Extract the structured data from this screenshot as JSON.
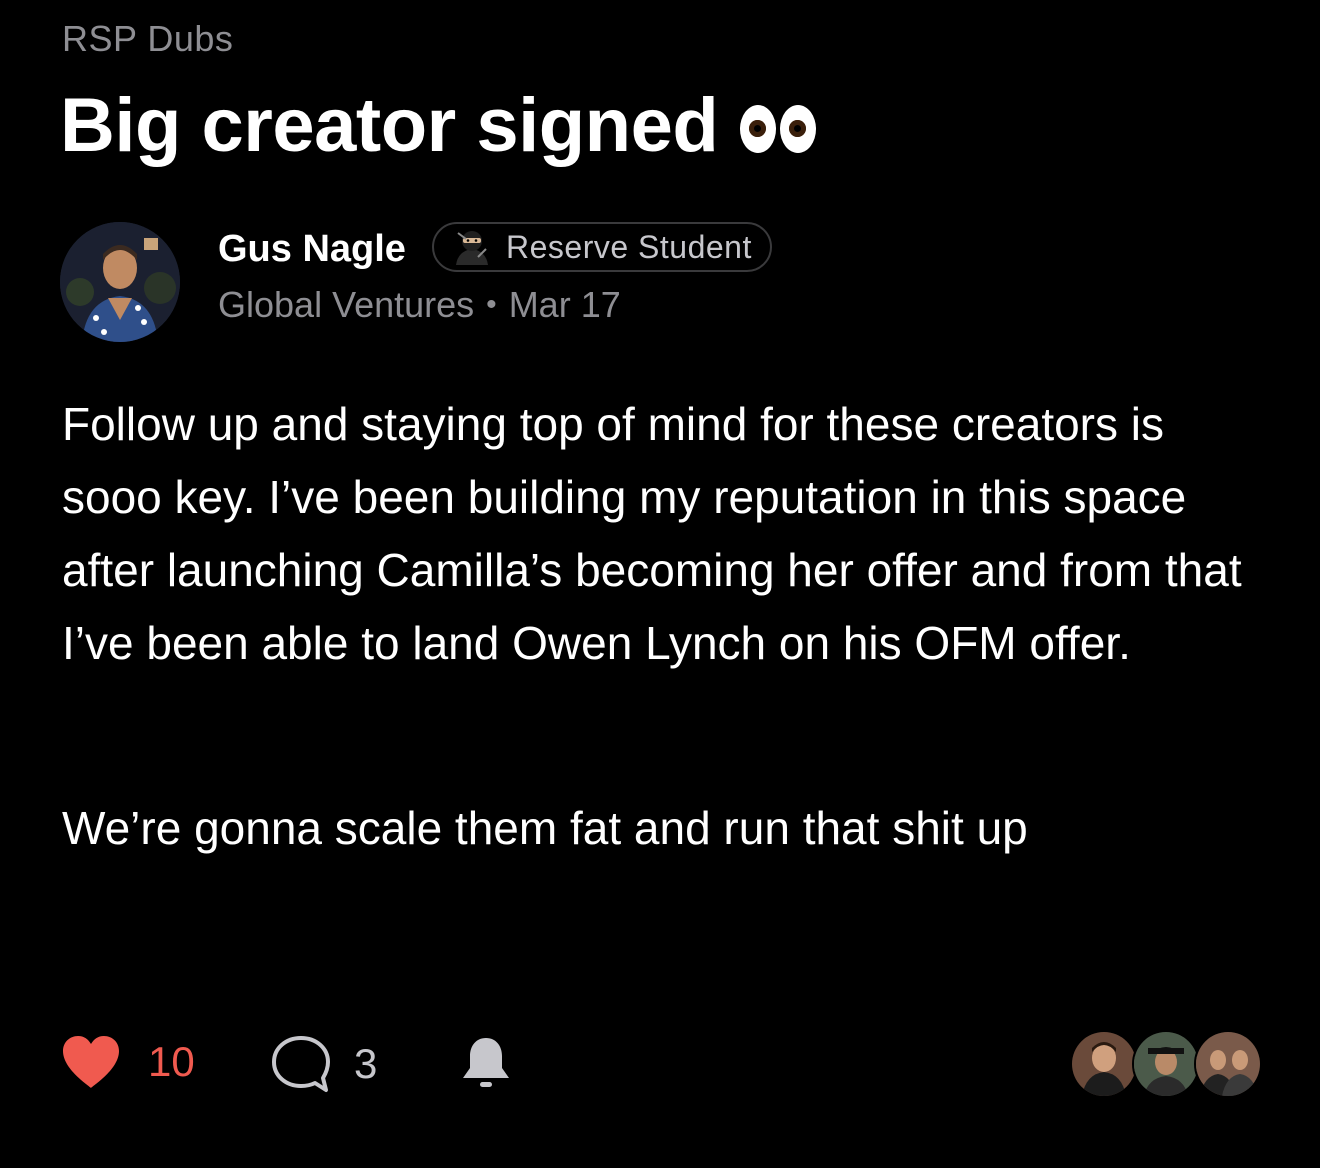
{
  "community": "RSP Dubs",
  "post": {
    "title": "Big creator signed",
    "title_emoji": "eyes-emoji",
    "author": {
      "name": "Gus Nagle",
      "badge": {
        "label": "Reserve Student",
        "icon": "ninja-icon"
      },
      "group": "Global Ventures",
      "separator": "•",
      "date": "Mar 17"
    },
    "body": {
      "paragraph_1": "Follow up and staying top of mind for these creators is sooo key. I’ve been building my reputation in this space after launching Camilla’s becoming her offer and from that I’ve been able to land Owen Lynch on his OFM offer.",
      "paragraph_2": "We’re gonna scale them fat and run that shit up"
    }
  },
  "actions": {
    "likes": "10",
    "like_icon": "heart-icon",
    "like_color": "#f05a4f",
    "comments": "3",
    "comment_icon": "comment-bubble-icon",
    "bell_icon": "bell-icon",
    "participants_count_shown": 3
  },
  "colors": {
    "background": "#000000",
    "text_primary": "#ffffff",
    "text_secondary": "#8e8e93",
    "badge_border": "#3a3a3c"
  }
}
